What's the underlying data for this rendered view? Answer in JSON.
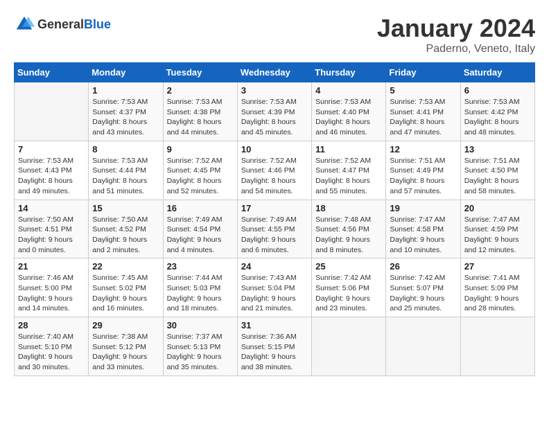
{
  "header": {
    "logo_general": "General",
    "logo_blue": "Blue",
    "month_year": "January 2024",
    "location": "Paderno, Veneto, Italy"
  },
  "weekdays": [
    "Sunday",
    "Monday",
    "Tuesday",
    "Wednesday",
    "Thursday",
    "Friday",
    "Saturday"
  ],
  "weeks": [
    [
      {
        "day": "",
        "sunrise": "",
        "sunset": "",
        "daylight": ""
      },
      {
        "day": "1",
        "sunrise": "Sunrise: 7:53 AM",
        "sunset": "Sunset: 4:37 PM",
        "daylight": "Daylight: 8 hours and 43 minutes."
      },
      {
        "day": "2",
        "sunrise": "Sunrise: 7:53 AM",
        "sunset": "Sunset: 4:38 PM",
        "daylight": "Daylight: 8 hours and 44 minutes."
      },
      {
        "day": "3",
        "sunrise": "Sunrise: 7:53 AM",
        "sunset": "Sunset: 4:39 PM",
        "daylight": "Daylight: 8 hours and 45 minutes."
      },
      {
        "day": "4",
        "sunrise": "Sunrise: 7:53 AM",
        "sunset": "Sunset: 4:40 PM",
        "daylight": "Daylight: 8 hours and 46 minutes."
      },
      {
        "day": "5",
        "sunrise": "Sunrise: 7:53 AM",
        "sunset": "Sunset: 4:41 PM",
        "daylight": "Daylight: 8 hours and 47 minutes."
      },
      {
        "day": "6",
        "sunrise": "Sunrise: 7:53 AM",
        "sunset": "Sunset: 4:42 PM",
        "daylight": "Daylight: 8 hours and 48 minutes."
      }
    ],
    [
      {
        "day": "7",
        "sunrise": "Sunrise: 7:53 AM",
        "sunset": "Sunset: 4:43 PM",
        "daylight": "Daylight: 8 hours and 49 minutes."
      },
      {
        "day": "8",
        "sunrise": "Sunrise: 7:53 AM",
        "sunset": "Sunset: 4:44 PM",
        "daylight": "Daylight: 8 hours and 51 minutes."
      },
      {
        "day": "9",
        "sunrise": "Sunrise: 7:52 AM",
        "sunset": "Sunset: 4:45 PM",
        "daylight": "Daylight: 8 hours and 52 minutes."
      },
      {
        "day": "10",
        "sunrise": "Sunrise: 7:52 AM",
        "sunset": "Sunset: 4:46 PM",
        "daylight": "Daylight: 8 hours and 54 minutes."
      },
      {
        "day": "11",
        "sunrise": "Sunrise: 7:52 AM",
        "sunset": "Sunset: 4:47 PM",
        "daylight": "Daylight: 8 hours and 55 minutes."
      },
      {
        "day": "12",
        "sunrise": "Sunrise: 7:51 AM",
        "sunset": "Sunset: 4:49 PM",
        "daylight": "Daylight: 8 hours and 57 minutes."
      },
      {
        "day": "13",
        "sunrise": "Sunrise: 7:51 AM",
        "sunset": "Sunset: 4:50 PM",
        "daylight": "Daylight: 8 hours and 58 minutes."
      }
    ],
    [
      {
        "day": "14",
        "sunrise": "Sunrise: 7:50 AM",
        "sunset": "Sunset: 4:51 PM",
        "daylight": "Daylight: 9 hours and 0 minutes."
      },
      {
        "day": "15",
        "sunrise": "Sunrise: 7:50 AM",
        "sunset": "Sunset: 4:52 PM",
        "daylight": "Daylight: 9 hours and 2 minutes."
      },
      {
        "day": "16",
        "sunrise": "Sunrise: 7:49 AM",
        "sunset": "Sunset: 4:54 PM",
        "daylight": "Daylight: 9 hours and 4 minutes."
      },
      {
        "day": "17",
        "sunrise": "Sunrise: 7:49 AM",
        "sunset": "Sunset: 4:55 PM",
        "daylight": "Daylight: 9 hours and 6 minutes."
      },
      {
        "day": "18",
        "sunrise": "Sunrise: 7:48 AM",
        "sunset": "Sunset: 4:56 PM",
        "daylight": "Daylight: 9 hours and 8 minutes."
      },
      {
        "day": "19",
        "sunrise": "Sunrise: 7:47 AM",
        "sunset": "Sunset: 4:58 PM",
        "daylight": "Daylight: 9 hours and 10 minutes."
      },
      {
        "day": "20",
        "sunrise": "Sunrise: 7:47 AM",
        "sunset": "Sunset: 4:59 PM",
        "daylight": "Daylight: 9 hours and 12 minutes."
      }
    ],
    [
      {
        "day": "21",
        "sunrise": "Sunrise: 7:46 AM",
        "sunset": "Sunset: 5:00 PM",
        "daylight": "Daylight: 9 hours and 14 minutes."
      },
      {
        "day": "22",
        "sunrise": "Sunrise: 7:45 AM",
        "sunset": "Sunset: 5:02 PM",
        "daylight": "Daylight: 9 hours and 16 minutes."
      },
      {
        "day": "23",
        "sunrise": "Sunrise: 7:44 AM",
        "sunset": "Sunset: 5:03 PM",
        "daylight": "Daylight: 9 hours and 18 minutes."
      },
      {
        "day": "24",
        "sunrise": "Sunrise: 7:43 AM",
        "sunset": "Sunset: 5:04 PM",
        "daylight": "Daylight: 9 hours and 21 minutes."
      },
      {
        "day": "25",
        "sunrise": "Sunrise: 7:42 AM",
        "sunset": "Sunset: 5:06 PM",
        "daylight": "Daylight: 9 hours and 23 minutes."
      },
      {
        "day": "26",
        "sunrise": "Sunrise: 7:42 AM",
        "sunset": "Sunset: 5:07 PM",
        "daylight": "Daylight: 9 hours and 25 minutes."
      },
      {
        "day": "27",
        "sunrise": "Sunrise: 7:41 AM",
        "sunset": "Sunset: 5:09 PM",
        "daylight": "Daylight: 9 hours and 28 minutes."
      }
    ],
    [
      {
        "day": "28",
        "sunrise": "Sunrise: 7:40 AM",
        "sunset": "Sunset: 5:10 PM",
        "daylight": "Daylight: 9 hours and 30 minutes."
      },
      {
        "day": "29",
        "sunrise": "Sunrise: 7:38 AM",
        "sunset": "Sunset: 5:12 PM",
        "daylight": "Daylight: 9 hours and 33 minutes."
      },
      {
        "day": "30",
        "sunrise": "Sunrise: 7:37 AM",
        "sunset": "Sunset: 5:13 PM",
        "daylight": "Daylight: 9 hours and 35 minutes."
      },
      {
        "day": "31",
        "sunrise": "Sunrise: 7:36 AM",
        "sunset": "Sunset: 5:15 PM",
        "daylight": "Daylight: 9 hours and 38 minutes."
      },
      {
        "day": "",
        "sunrise": "",
        "sunset": "",
        "daylight": ""
      },
      {
        "day": "",
        "sunrise": "",
        "sunset": "",
        "daylight": ""
      },
      {
        "day": "",
        "sunrise": "",
        "sunset": "",
        "daylight": ""
      }
    ]
  ]
}
